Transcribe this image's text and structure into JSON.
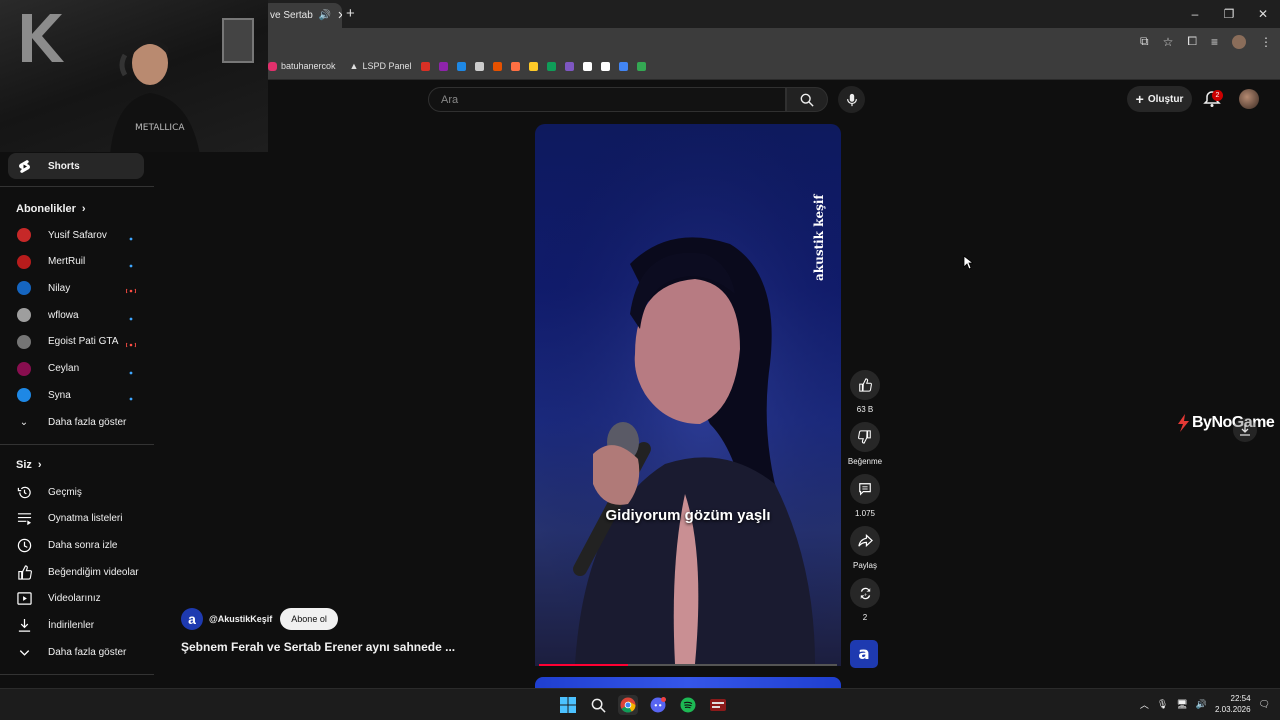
{
  "browser": {
    "tab_title": "ve Sertab",
    "new_tab": "+",
    "window_controls": [
      "–",
      "❐",
      "✕"
    ]
  },
  "bookmarks": {
    "items": [
      {
        "label": "batuhanercok",
        "icon": "instagram-icon",
        "color": "#e1306c"
      },
      {
        "label": "LSPD Panel",
        "icon": "lspd-icon",
        "color": "#cccccc"
      }
    ],
    "extra_icon_colors": [
      "#d93025",
      "#8e24aa",
      "#1e88e5",
      "#cccccc",
      "#e65100",
      "#ff7043",
      "#ffca28",
      "#0f9d58",
      "#7e57c2",
      "#ffffff",
      "#ffffff",
      "#4285f4",
      "#34a853"
    ]
  },
  "header": {
    "search_placeholder": "Ara",
    "create_label": "Oluştur",
    "notif_count": "2"
  },
  "sidebar": {
    "shorts_label": "Shorts",
    "subs_heading": "Abonelikler",
    "subscriptions": [
      {
        "name": "Yusif Safarov",
        "status": "dot",
        "color": "#c62828"
      },
      {
        "name": "MertRuil",
        "status": "dot",
        "color": "#b71c1c"
      },
      {
        "name": "Nilay",
        "status": "live",
        "color": "#1565c0"
      },
      {
        "name": "wflowa",
        "status": "dot",
        "color": "#9e9e9e"
      },
      {
        "name": "Egoist Pati GTA",
        "status": "live",
        "color": "#757575"
      },
      {
        "name": "Ceylan",
        "status": "dot",
        "color": "#880e4f"
      },
      {
        "name": "Syna",
        "status": "dot",
        "color": "#1e88e5"
      }
    ],
    "show_more_subs": "Daha fazla göster",
    "you_heading": "Siz",
    "you_items": [
      {
        "label": "Geçmiş",
        "icon": "history-icon"
      },
      {
        "label": "Oynatma listeleri",
        "icon": "playlists-icon"
      },
      {
        "label": "Daha sonra izle",
        "icon": "watch-later-icon"
      },
      {
        "label": "Beğendiğim videolar",
        "icon": "liked-icon"
      },
      {
        "label": "Videolarınız",
        "icon": "your-videos-icon"
      },
      {
        "label": "İndirilenler",
        "icon": "downloads-icon"
      },
      {
        "label": "Daha fazla göster",
        "icon": "chevron-down-icon"
      }
    ]
  },
  "short": {
    "caption": "Gidiyorum gözüm yaşlı",
    "brand_overlay": "akustik keşif",
    "progress": 0.3,
    "channel_handle": "@AkustikKeşif",
    "subscribe_label": "Abone ol",
    "title": "Şebnem Ferah ve Sertab Erener aynı sahnede ...",
    "channel_letter": "a"
  },
  "actions": {
    "like_count": "63 B",
    "dislike_label": "Beğenme",
    "comment_count": "1.075",
    "share_label": "Paylaş",
    "remix_count": "2"
  },
  "overlay": {
    "watermark": "ByNoGame"
  },
  "taskbar": {
    "time": "22:54",
    "date": "2.03.2026"
  }
}
